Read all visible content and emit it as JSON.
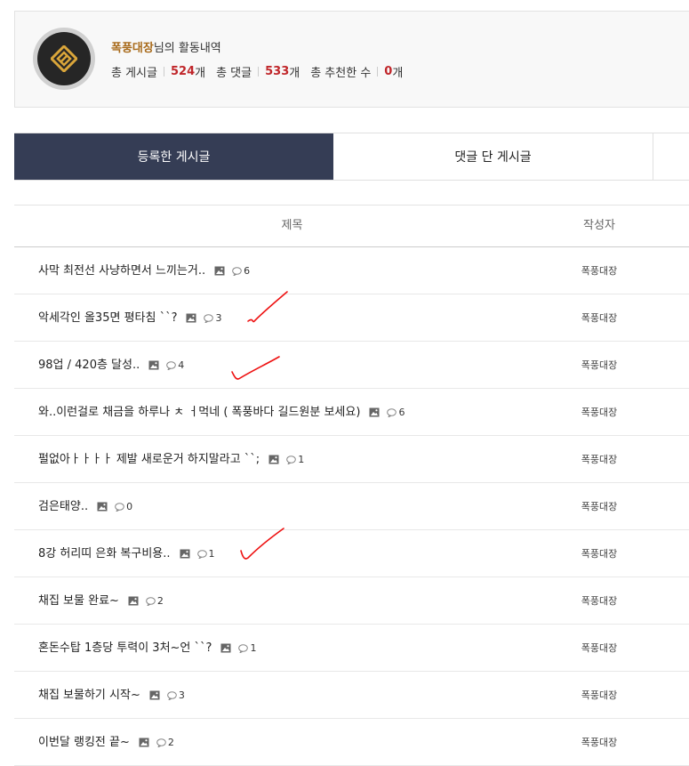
{
  "profile": {
    "name": "폭풍대장",
    "name_suffix": "님의 활동내역",
    "posts_label": "총 게시글",
    "posts_count": "524",
    "comments_label": "총 댓글",
    "comments_count": "533",
    "likes_label": "총 추천한 수",
    "likes_count": "0",
    "unit": "개"
  },
  "tabs": [
    "등록한 게시글",
    "댓글 단 게시글"
  ],
  "table": {
    "headers": {
      "title": "제목",
      "author": "작성자"
    },
    "rows": [
      {
        "title": "사막 최전선 사냥하면서 느끼는거..",
        "comments": "6",
        "author": "폭풍대장"
      },
      {
        "title": "악세각인 올35면 평타침 ``?",
        "comments": "3",
        "author": "폭풍대장"
      },
      {
        "title": "98업 / 420층 달성..",
        "comments": "4",
        "author": "폭풍대장"
      },
      {
        "title": "와..이런걸로 채금을 하루나 ㅊ ㅓ먹네 ( 폭풍바다 길드원분 보세요)",
        "comments": "6",
        "author": "폭풍대장"
      },
      {
        "title": "펄없아ㅏㅏㅏㅏ 제발 새로운거 하지말라고 ``;",
        "comments": "1",
        "author": "폭풍대장"
      },
      {
        "title": "검은태양..",
        "comments": "0",
        "author": "폭풍대장"
      },
      {
        "title": "8강 허리띠 은화 복구비용..",
        "comments": "1",
        "author": "폭풍대장"
      },
      {
        "title": "채집 보물 완료~",
        "comments": "2",
        "author": "폭풍대장"
      },
      {
        "title": "혼돈수탑 1층당 투력이 3처~언 ``?",
        "comments": "1",
        "author": "폭풍대장"
      },
      {
        "title": "채집 보물하기 시작~",
        "comments": "3",
        "author": "폭풍대장"
      },
      {
        "title": "이번달 랭킹전 끝~",
        "comments": "2",
        "author": "폭풍대장"
      }
    ]
  },
  "colors": {
    "accent_name": "#a86a1a",
    "count_red": "#c0262a",
    "tab_active": "#353d55",
    "check_mark": "#e11"
  },
  "icons": {
    "image": "image-icon",
    "comment": "comment-icon",
    "logo": "guild-emblem-icon"
  }
}
